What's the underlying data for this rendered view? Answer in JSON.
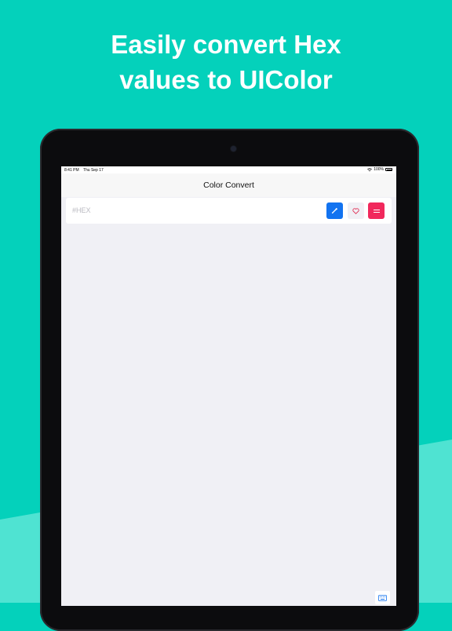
{
  "promo": {
    "headline_line1": "Easily convert Hex",
    "headline_line2": "values to UIColor"
  },
  "colors": {
    "background": "#04d1bb",
    "accent_light": "#4fe3d2",
    "device_bezel": "#0c0c0e",
    "screen_bg": "#f0f0f5",
    "picker_button": "#1273f0",
    "menu_button": "#f1285c",
    "favorite_icon": "#e0284f"
  },
  "status_bar": {
    "time": "8:41 PM",
    "date": "Thu Sep 17",
    "battery": "100%",
    "icons": [
      "wifi-icon",
      "battery-icon"
    ]
  },
  "app": {
    "nav_title": "Color Convert",
    "hex_input": {
      "placeholder": "#HEX",
      "value": ""
    },
    "buttons": [
      {
        "name": "color-picker-button",
        "icon": "eyedropper-icon"
      },
      {
        "name": "favorite-button",
        "icon": "heart-icon"
      },
      {
        "name": "menu-button",
        "icon": "menu-lines-icon"
      }
    ],
    "keyboard_button_icon": "keyboard-icon"
  }
}
